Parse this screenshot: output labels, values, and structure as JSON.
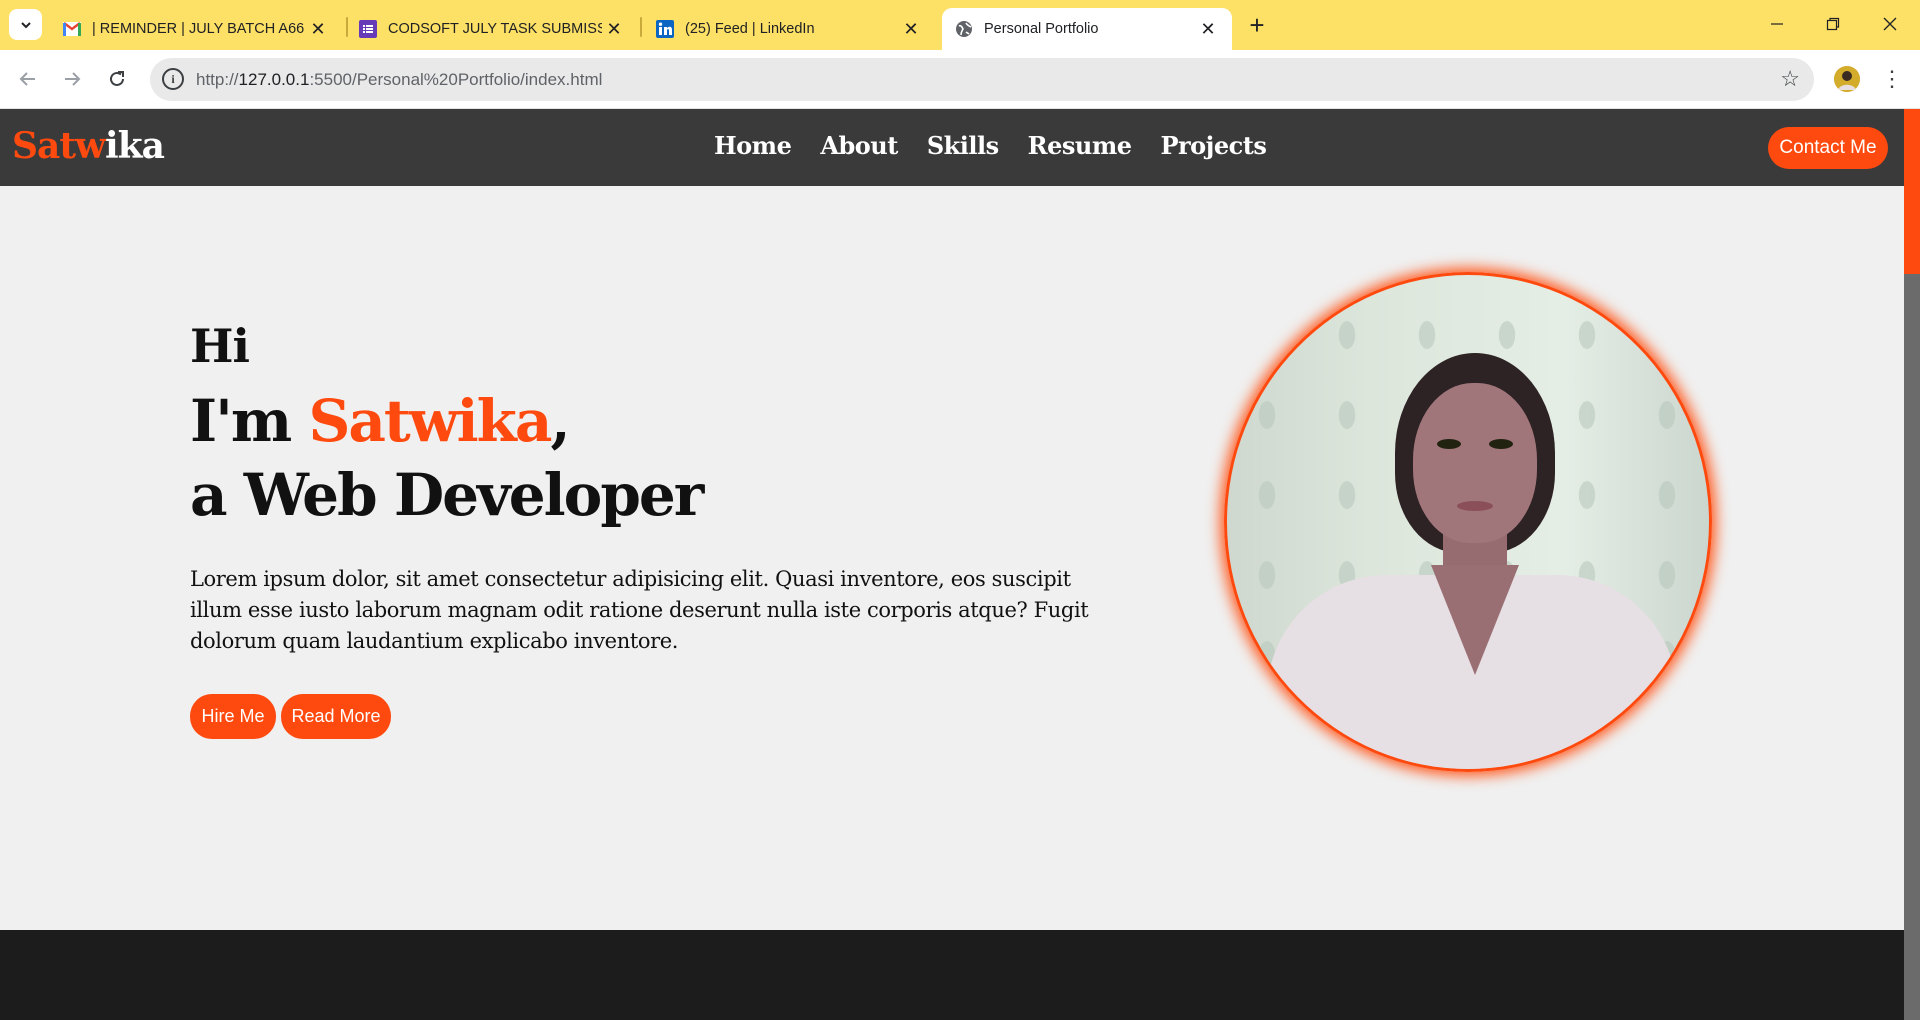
{
  "browser": {
    "tabs": [
      {
        "title": "| REMINDER | JULY BATCH A66 ...",
        "icon": "gmail-icon"
      },
      {
        "title": "CODSOFT JULY TASK SUBMISSI...",
        "icon": "forms-icon"
      },
      {
        "title": "(25) Feed | LinkedIn",
        "icon": "linkedin-icon"
      },
      {
        "title": "Personal Portfolio",
        "icon": "globe-icon",
        "active": true
      }
    ],
    "url_prefix": "http://",
    "url_host": "127.0.0.1",
    "url_rest": ":5500/Personal%20Portfolio/index.html",
    "colors": {
      "tabstrip": "#fde066"
    }
  },
  "site": {
    "logo_part1": "Satw",
    "logo_part2": "ika",
    "nav": [
      "Home",
      "About",
      "Skills",
      "Resume",
      "Projects"
    ],
    "contact_label": "Contact Me",
    "hero": {
      "greeting": "Hi",
      "im": "I'm ",
      "name": "Satwika",
      "comma": ",",
      "role": "a Web Developer",
      "paragraph": "Lorem ipsum dolor, sit amet consectetur adipisicing elit. Quasi inventore, eos suscipit illum esse iusto laborum magnam odit ratione deserunt nulla iste corporis atque? Fugit dolorum quam laudantium explicabo inventore.",
      "hire_label": "Hire Me",
      "read_label": "Read More"
    },
    "colors": {
      "accent": "#ff4a0f",
      "navbar": "#3a3a3a",
      "background": "#f0f0f0",
      "footer": "#1c1c1c"
    }
  }
}
